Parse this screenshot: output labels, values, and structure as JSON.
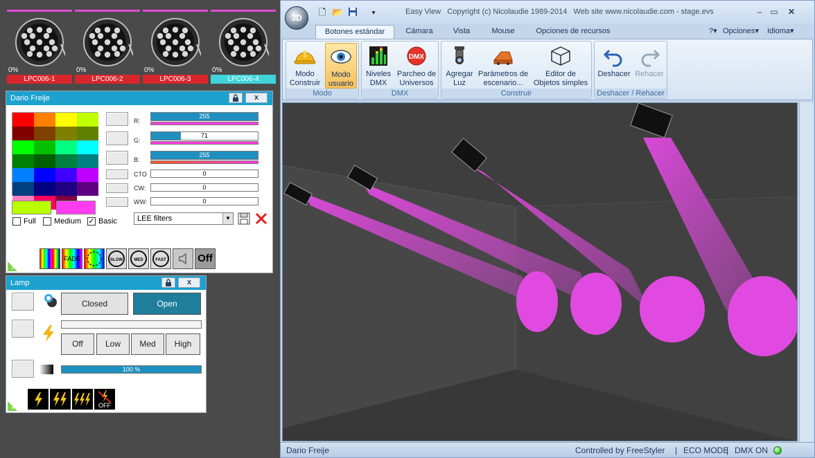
{
  "fixtures": [
    {
      "name": "LPC006-1",
      "level": "0%",
      "selected": false
    },
    {
      "name": "LPC006-2",
      "level": "0%",
      "selected": false
    },
    {
      "name": "LPC006-3",
      "level": "0%",
      "selected": false
    },
    {
      "name": "LPC006-4",
      "level": "0%",
      "selected": true
    }
  ],
  "color_panel": {
    "title": "Dario Freije",
    "lock_icon": "lock-icon",
    "close_label": "x",
    "palette": [
      "#ff0000",
      "#ff8000",
      "#ffff00",
      "#c0ff00",
      "#800000",
      "#804000",
      "#808000",
      "#608000",
      "#00ff00",
      "#00c000",
      "#00ff80",
      "#00ffff",
      "#008000",
      "#006000",
      "#008040",
      "#008080",
      "#0080ff",
      "#0000ff",
      "#4000ff",
      "#c000ff",
      "#004080",
      "#000080",
      "#200080",
      "#600080",
      "#ff80c0",
      "#ff0060",
      "#800040",
      "#ffffff"
    ],
    "primary_color": "#b8ff00",
    "secondary_color": "#ff3cf0",
    "checks": [
      {
        "label": "Full",
        "checked": false
      },
      {
        "label": "Medium",
        "checked": false
      },
      {
        "label": "Basic",
        "checked": true
      }
    ],
    "channels": [
      {
        "label": "R:",
        "value": "255",
        "level": 1.0,
        "color": "#ff3ce0"
      },
      {
        "label": "G:",
        "value": "71",
        "level": 0.28,
        "color": "#ff3ce0"
      },
      {
        "label": "B:",
        "value": "255",
        "level": 1.0,
        "color": "#ff3ce0"
      },
      {
        "label": "CTO",
        "value": "0",
        "level": 0.0
      },
      {
        "label": "CW:",
        "value": "0",
        "level": 0.0
      },
      {
        "label": "WW:",
        "value": "0",
        "level": 0.0
      }
    ],
    "filter_select": "LEE filters",
    "fx_buttons": {
      "fade": "FADE",
      "slow": "SLOW",
      "med": "MED",
      "fast": "FAST",
      "off": "Off"
    }
  },
  "lamp_panel": {
    "title": "Lamp",
    "close_label": "x",
    "shutter_closed": "Closed",
    "shutter_open": "Open",
    "strobe_off": "Off",
    "strobe_low": "Low",
    "strobe_med": "Med",
    "strobe_high": "High",
    "dimmer_value": "100 %",
    "dimmer_level": 1.0,
    "off_label": "OFF"
  },
  "app": {
    "orb_label": "3D",
    "title_app": "Easy View",
    "title_copyright": "Copyright (c) Nicolaudie 1989-2014",
    "title_website": "Web site www.nicolaudie.com - stage.evs",
    "tabs": [
      "Botones estándar",
      "Cámara",
      "Vista",
      "Mouse",
      "Opciones de recursos"
    ],
    "active_tab": 0,
    "right_menu": {
      "help": "?",
      "options": "Opciones",
      "language": "Idioma"
    },
    "groups": {
      "modo": "Modo",
      "dmx": "DMX",
      "construir": "Construir",
      "undo": "Deshacer / Rehacer"
    },
    "buttons": {
      "modo_construir": [
        "Modo",
        "Construir"
      ],
      "modo_usuario": [
        "Modo",
        "usuario"
      ],
      "niveles_dmx": [
        "Niveles",
        "DMX"
      ],
      "parcheo": [
        "Parcheo de",
        "Universos"
      ],
      "agregar_luz": [
        "Agregar",
        "Luz"
      ],
      "parametros": [
        "Parámetros de",
        "escenario..."
      ],
      "editor": [
        "Editor de",
        "Objetos simples"
      ],
      "deshacer": "Deshacer",
      "rehacer": "Rehacer"
    },
    "status": {
      "user": "Dario Freije",
      "controlled": "Controlled by FreeStyler",
      "eco": "ECO MODE",
      "dmx": "DMX ON"
    },
    "accent_color": "#1da1cf",
    "beam_color": "#e04ae0"
  }
}
